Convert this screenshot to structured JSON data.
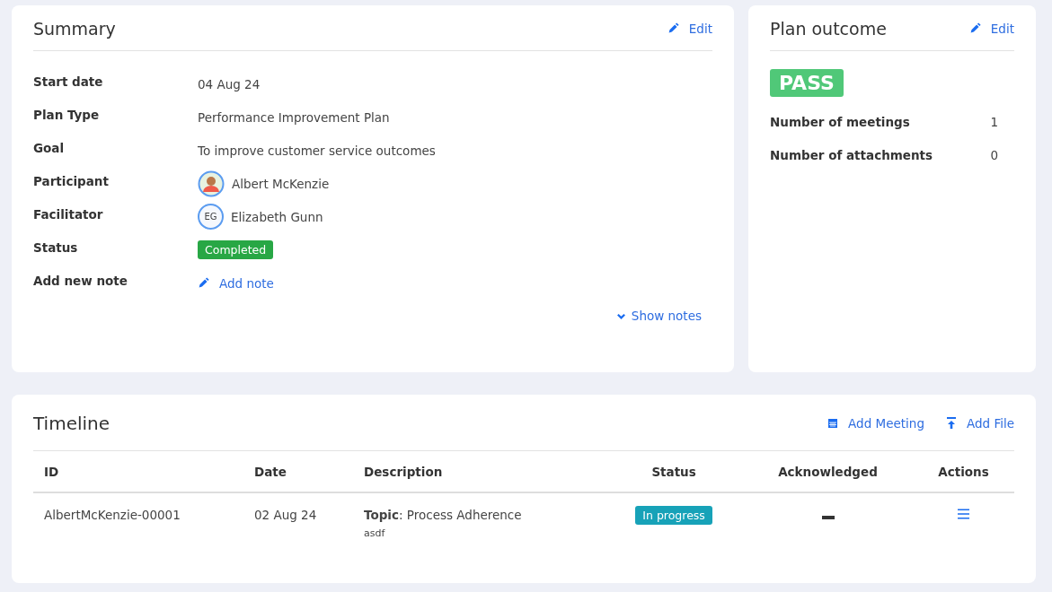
{
  "summary": {
    "title": "Summary",
    "edit": "Edit",
    "fields": [
      {
        "label": "Start date",
        "kind": "text",
        "value": "04 Aug 24"
      },
      {
        "label": "Plan Type",
        "kind": "text",
        "value": "Performance Improvement Plan"
      },
      {
        "label": "Goal",
        "kind": "text",
        "value": "To improve customer service outcomes"
      },
      {
        "label": "Participant",
        "kind": "person",
        "value": "Albert McKenzie"
      },
      {
        "label": "Facilitator",
        "kind": "person",
        "initials": "EG",
        "value": "Elizabeth Gunn"
      },
      {
        "label": "Status",
        "kind": "badge",
        "value": "Completed",
        "color": "#28a745"
      },
      {
        "label": "Add new note",
        "kind": "link",
        "value": "Add note"
      }
    ],
    "show_notes": "Show notes"
  },
  "plan_outcome": {
    "title": "Plan outcome",
    "edit": "Edit",
    "result": "PASS",
    "stats": [
      {
        "label": "Number of meetings",
        "value": "1"
      },
      {
        "label": "Number of attachments",
        "value": "0"
      }
    ]
  },
  "timeline": {
    "title": "Timeline",
    "actions": [
      {
        "kind": "calendar",
        "label": "Add Meeting"
      },
      {
        "kind": "upload",
        "label": "Add File"
      }
    ],
    "columns": [
      "ID",
      "Date",
      "Description",
      "Status",
      "Acknowledged",
      "Actions"
    ],
    "rows": [
      {
        "id": "AlbertMcKenzie-00001",
        "date": "02 Aug 24",
        "description": "**Topic**: Process Adherence",
        "note": "asdf",
        "status": "In progress",
        "color": "#17a2b8",
        "acknowledged": false
      }
    ]
  }
}
